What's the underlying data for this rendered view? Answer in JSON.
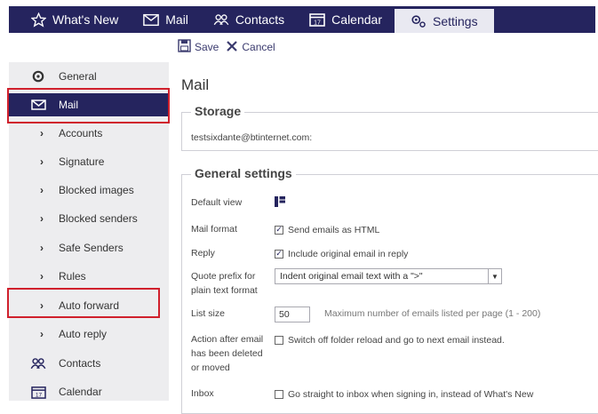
{
  "nav": {
    "tabs": [
      {
        "label": "What's New",
        "icon": "star-icon"
      },
      {
        "label": "Mail",
        "icon": "envelope-icon"
      },
      {
        "label": "Contacts",
        "icon": "contacts-icon"
      },
      {
        "label": "Calendar",
        "icon": "calendar-icon"
      },
      {
        "label": "Settings",
        "icon": "settings-icon"
      }
    ],
    "active": "Settings"
  },
  "toolbar": {
    "save_label": "Save",
    "cancel_label": "Cancel"
  },
  "sidebar": {
    "items": [
      {
        "label": "General"
      },
      {
        "label": "Mail"
      },
      {
        "label": "Accounts"
      },
      {
        "label": "Signature"
      },
      {
        "label": "Blocked images"
      },
      {
        "label": "Blocked senders"
      },
      {
        "label": "Safe Senders"
      },
      {
        "label": "Rules"
      },
      {
        "label": "Auto forward"
      },
      {
        "label": "Auto reply"
      },
      {
        "label": "Contacts"
      },
      {
        "label": "Calendar"
      }
    ]
  },
  "main": {
    "title": "Mail",
    "storage": {
      "heading": "Storage",
      "account": "testsixdante@btinternet.com:"
    },
    "general": {
      "heading": "General settings",
      "default_view_label": "Default view",
      "mail_format_label": "Mail format",
      "mail_format_option": "Send emails as HTML",
      "reply_label": "Reply",
      "reply_option": "Include original email in reply",
      "quote_prefix_label_1": "Quote prefix for",
      "quote_prefix_label_2": "plain text format",
      "quote_prefix_value": "Indent original email text with a \">\"",
      "list_size_label": "List size",
      "list_size_value": "50",
      "list_size_hint": "Maximum number of emails listed per page (1 - 200)",
      "action_label_1": "Action after email",
      "action_label_2": "has been deleted",
      "action_label_3": "or moved",
      "action_option": "Switch off folder reload and go to next email instead.",
      "inbox_label": "Inbox",
      "inbox_option": "Go straight to inbox when signing in, instead of What's New"
    }
  },
  "colors": {
    "nav_bg": "#25245e",
    "highlight_red": "#d0202c",
    "sidebar_bg": "#ededef"
  }
}
